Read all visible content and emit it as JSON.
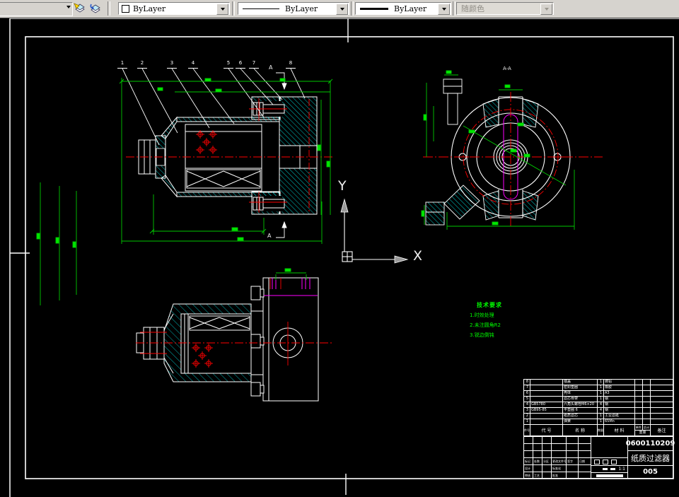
{
  "toolbar": {
    "color_control": "ByLayer",
    "linetype_control": "ByLayer",
    "lineweight_control": "ByLayer",
    "plot_style_control": "随颜色",
    "icons": [
      "dropdown-arrow",
      "make-object-layer-current",
      "layer-previous"
    ]
  },
  "drawing": {
    "view_label": "A-A",
    "section_label_top": "A",
    "section_label_bottom": "A",
    "ucs": {
      "x_axis": "X",
      "y_axis": "Y"
    },
    "balloons": [
      "1",
      "2",
      "3",
      "4",
      "5",
      "6",
      "7",
      "8"
    ],
    "notes": {
      "title": "技术要求",
      "lines": [
        "1.时效处理",
        "2.未注圆角R2",
        "3.锐边倒钝"
      ]
    },
    "colors": {
      "dimension": "#00c800",
      "centerline": "#ff0000",
      "hatch": "#00e0e0",
      "geometry": "#ffffff",
      "phantom": "#ff00ff"
    }
  },
  "title_block": {
    "headers": {
      "seq": "件号",
      "code": "代 号",
      "name": "名 称",
      "qty": "数量",
      "material": "材 料",
      "weight_unit": "单件",
      "weight_total": "总计",
      "weight": "重量",
      "remark": "备注"
    },
    "parts": [
      {
        "seq": "8",
        "code": "",
        "name": "端盖",
        "qty": "1",
        "material": "铸铝"
      },
      {
        "seq": "7",
        "code": "",
        "name": "密封垫圈",
        "qty": "1",
        "material": "橡胶"
      },
      {
        "seq": "6",
        "code": "",
        "name": "壳体",
        "qty": "1",
        "material": "A3"
      },
      {
        "seq": "5",
        "code": "",
        "name": "滤芯骨架",
        "qty": "1",
        "material": "钢"
      },
      {
        "seq": "4",
        "code": "GB5780",
        "name": "六角头螺栓M6×20",
        "qty": "4",
        "material": "钢"
      },
      {
        "seq": "3",
        "code": "GB95-85",
        "name": "平垫圈 6",
        "qty": "4",
        "material": "钢"
      },
      {
        "seq": "2",
        "code": "",
        "name": "纸质滤芯",
        "qty": "1",
        "material": "工业滤纸"
      },
      {
        "seq": "1",
        "code": "",
        "name": "弹簧",
        "qty": "1",
        "material": "65Mn"
      }
    ],
    "sig_header": [
      "标记",
      "处数",
      "分区",
      "更改文件号",
      "签字",
      "日期"
    ],
    "sig_labels": {
      "design": "设计",
      "check": "审核",
      "standard": "标准化",
      "process": "工艺",
      "approve": "批准"
    },
    "scale": "1:1",
    "drawing_number": "0600110209",
    "product_name": "纸质过滤器",
    "sheet_number": "005"
  }
}
